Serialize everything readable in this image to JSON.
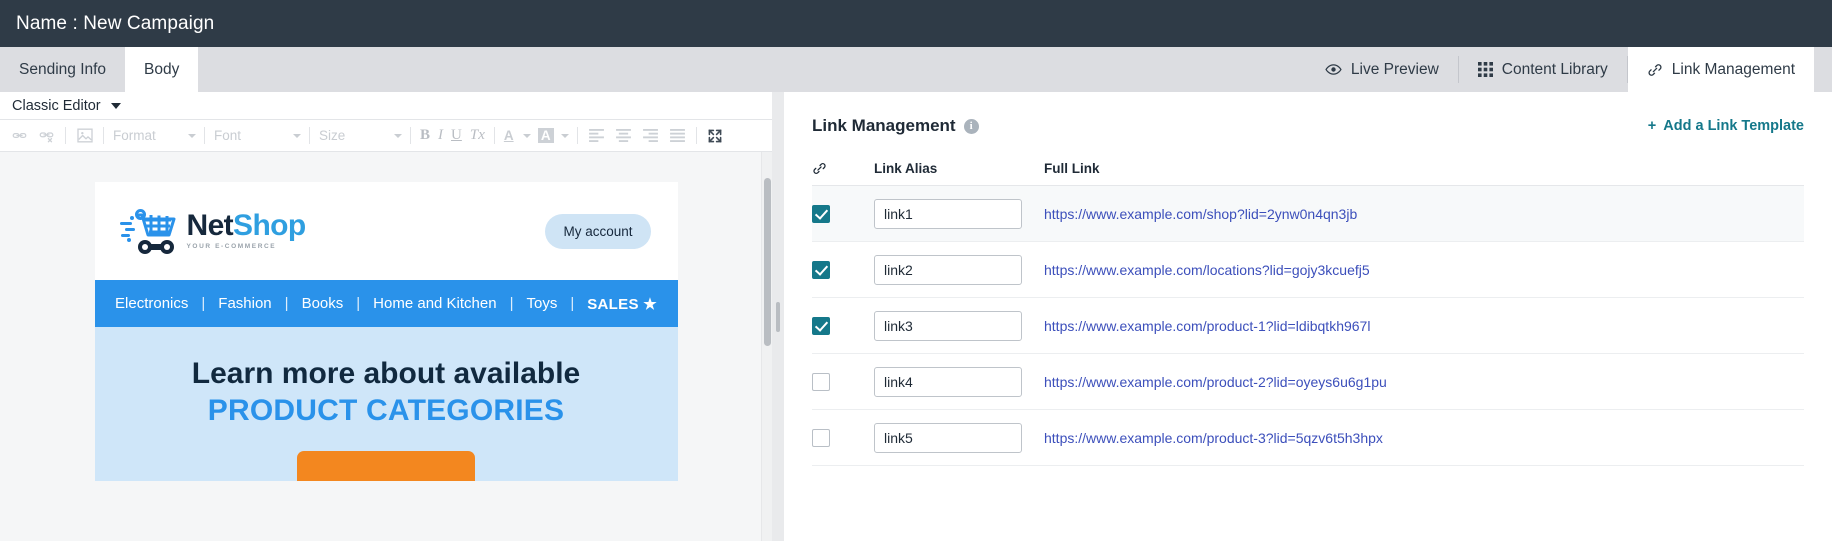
{
  "titlebar": {
    "title": "Name : New Campaign"
  },
  "tabs": {
    "left": [
      {
        "label": "Sending Info",
        "active": false,
        "icon": ""
      },
      {
        "label": "Body",
        "active": true,
        "icon": ""
      }
    ],
    "right": [
      {
        "label": "Live Preview",
        "active": false,
        "icon": "eye-icon"
      },
      {
        "label": "Content Library",
        "active": false,
        "icon": "grid-icon"
      },
      {
        "label": "Link Management",
        "active": true,
        "icon": "link-icon"
      }
    ]
  },
  "editor": {
    "mode_label": "Classic Editor",
    "toolbar": {
      "link": "link-icon",
      "unlink": "unlink-icon",
      "image": "image-icon",
      "format_label": "Format",
      "font_label": "Font",
      "size_label": "Size",
      "bold": "B",
      "italic": "I",
      "underline": "U",
      "remove_format": "Tx",
      "text_color": "A",
      "bg_color": "A",
      "align_left": "align-left-icon",
      "align_center": "align-center-icon",
      "align_right": "align-right-icon",
      "align_justify": "align-justify-icon",
      "maximize": "maximize-icon"
    }
  },
  "email_preview": {
    "logo": {
      "word_1": "Net",
      "word_2": "Shop",
      "tagline": "YOUR E-COMMERCE"
    },
    "account_button": "My account",
    "nav": [
      "Electronics",
      "Fashion",
      "Books",
      "Home and Kitchen",
      "Toys",
      "SALES ★"
    ],
    "nav_separator": "|",
    "hero": {
      "line1": "Learn more about available",
      "line2": "PRODUCT CATEGORIES"
    },
    "colors": {
      "nav_blue": "#2a92ea",
      "hero_bg": "#cfe6f9",
      "hero_accent": "#2a92ea",
      "cta_orange": "#f3871f",
      "logo_dark": "#16283c"
    }
  },
  "link_management": {
    "heading": "Link Management",
    "info_icon": "info-icon",
    "add_template_label": "Add a Link Template",
    "add_template_plus": "+",
    "columns": {
      "checkbox": "link-icon",
      "alias": "Link Alias",
      "full_link": "Full Link"
    },
    "accent_color": "#15788a",
    "link_color": "#3c4fbb",
    "rows": [
      {
        "checked": true,
        "alias": "link1",
        "full_link": "https://www.example.com/shop?lid=2ynw0n4qn3jb"
      },
      {
        "checked": true,
        "alias": "link2",
        "full_link": "https://www.example.com/locations?lid=gojy3kcuefj5"
      },
      {
        "checked": true,
        "alias": "link3",
        "full_link": "https://www.example.com/product-1?lid=ldibqtkh967l"
      },
      {
        "checked": false,
        "alias": "link4",
        "full_link": "https://www.example.com/product-2?lid=oyeys6u6g1pu"
      },
      {
        "checked": false,
        "alias": "link5",
        "full_link": "https://www.example.com/product-3?lid=5qzv6t5h3hpx"
      }
    ]
  }
}
